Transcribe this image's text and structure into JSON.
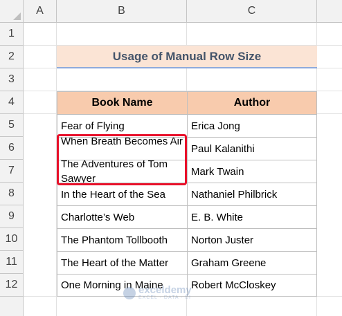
{
  "columns": [
    "A",
    "B",
    "C"
  ],
  "rows": [
    "1",
    "2",
    "3",
    "4",
    "5",
    "6",
    "7",
    "8",
    "9",
    "10",
    "11",
    "12"
  ],
  "title": "Usage of Manual Row Size",
  "table": {
    "headers": [
      "Book Name",
      "Author"
    ],
    "rows": [
      [
        "Fear of Flying",
        "Erica Jong"
      ],
      [
        "When Breath Becomes Air",
        "Paul Kalanithi"
      ],
      [
        "The Adventures of Tom Sawyer",
        "Mark Twain"
      ],
      [
        "In the Heart of the Sea",
        "Nathaniel Philbrick"
      ],
      [
        "Charlotte’s Web",
        "E. B. White"
      ],
      [
        "The Phantom Tollbooth",
        "Norton Juster"
      ],
      [
        "The Heart of the Matter",
        "Graham Greene"
      ],
      [
        "One Morning in Maine",
        "Robert McCloskey"
      ]
    ]
  },
  "watermark": {
    "name": "exceldemy",
    "tagline": "EXCEL · DATA · BI"
  },
  "colors": {
    "title_bg": "#fbe4d5",
    "title_text": "#44546a",
    "header_bg": "#f8cbad",
    "highlight": "#e8102a"
  }
}
